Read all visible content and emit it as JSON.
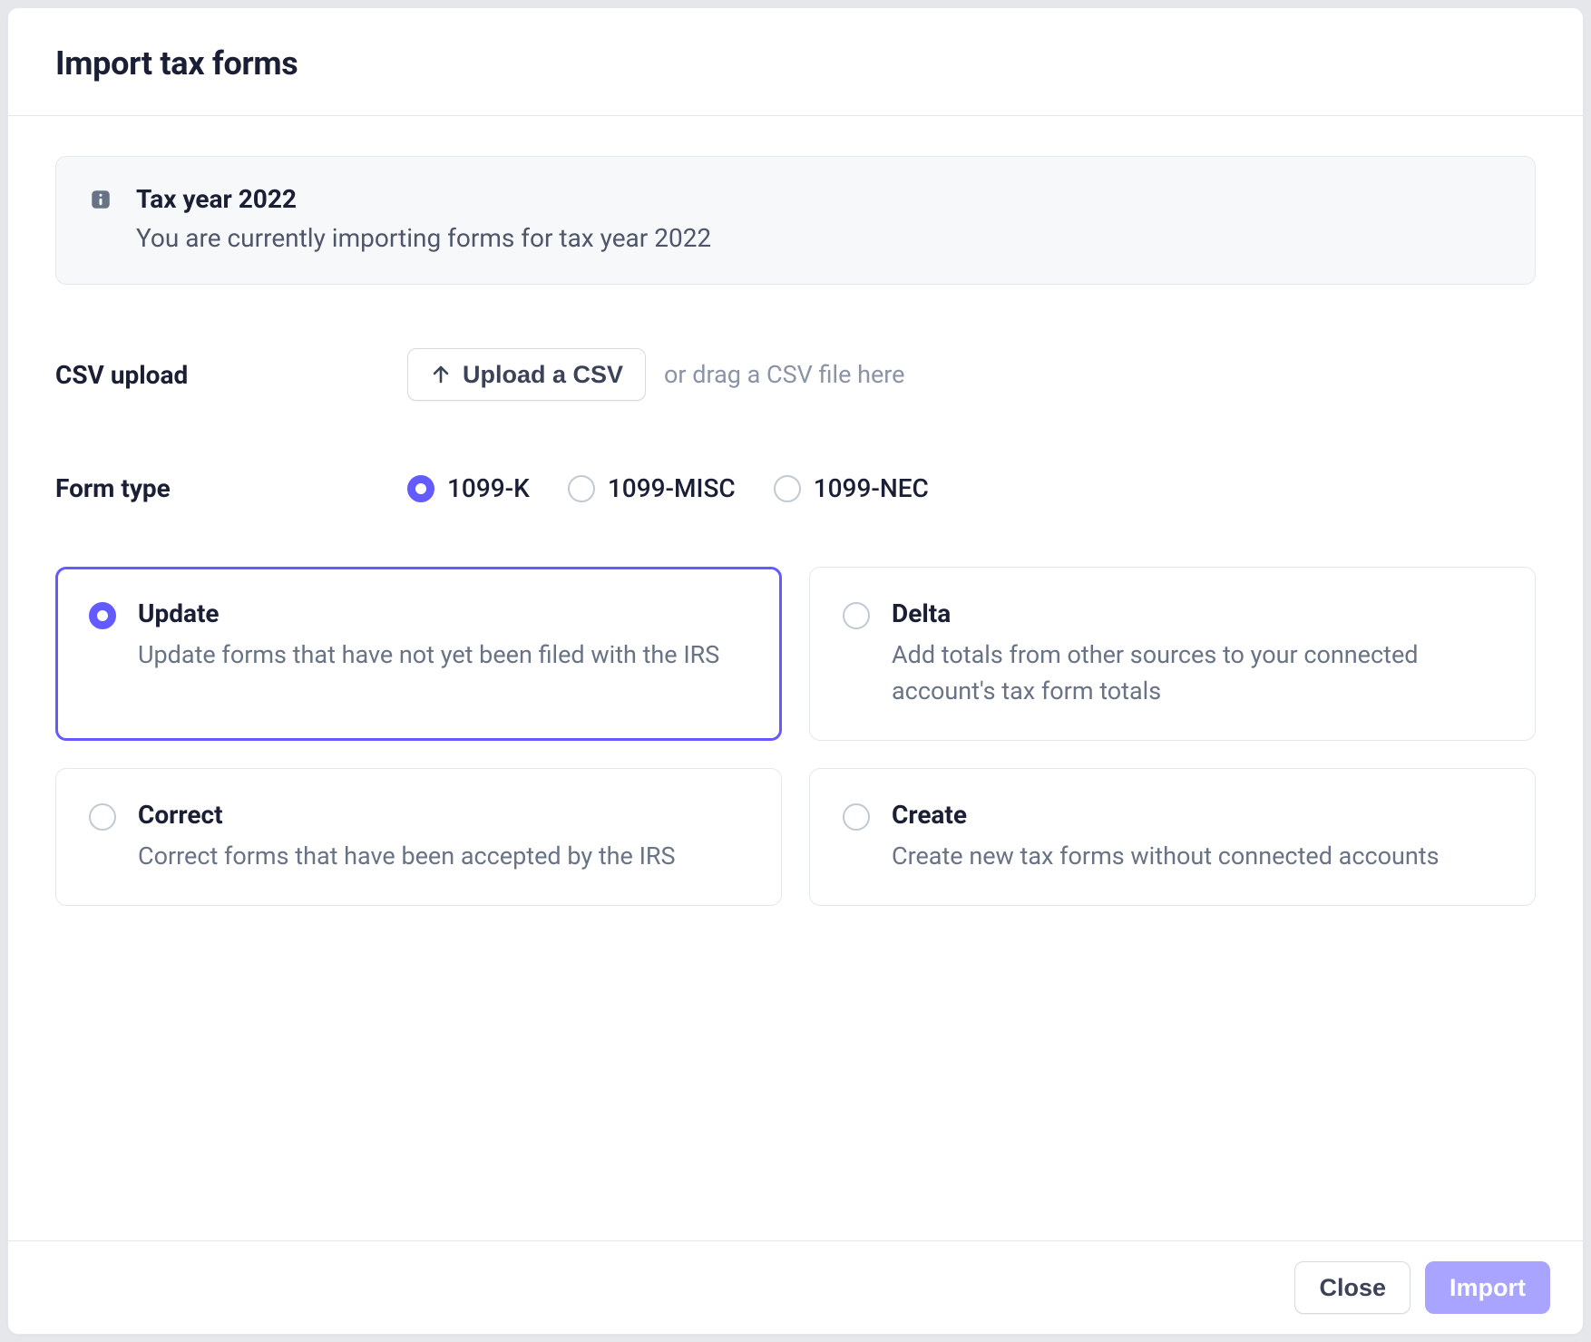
{
  "header": {
    "title": "Import tax forms"
  },
  "banner": {
    "title": "Tax year 2022",
    "description": "You are currently importing forms for tax year 2022"
  },
  "csv": {
    "label": "CSV upload",
    "button": "Upload a CSV",
    "hint": "or drag a CSV file here"
  },
  "formType": {
    "label": "Form type",
    "options": [
      {
        "label": "1099-K",
        "selected": true
      },
      {
        "label": "1099-MISC",
        "selected": false
      },
      {
        "label": "1099-NEC",
        "selected": false
      }
    ]
  },
  "actions": [
    {
      "title": "Update",
      "description": "Update forms that have not yet been filed with the IRS",
      "selected": true
    },
    {
      "title": "Delta",
      "description": "Add totals from other sources to your connected account's tax form totals",
      "selected": false
    },
    {
      "title": "Correct",
      "description": "Correct forms that have been accepted by the IRS",
      "selected": false
    },
    {
      "title": "Create",
      "description": "Create new tax forms without connected accounts",
      "selected": false
    }
  ],
  "footer": {
    "close": "Close",
    "import": "Import"
  }
}
